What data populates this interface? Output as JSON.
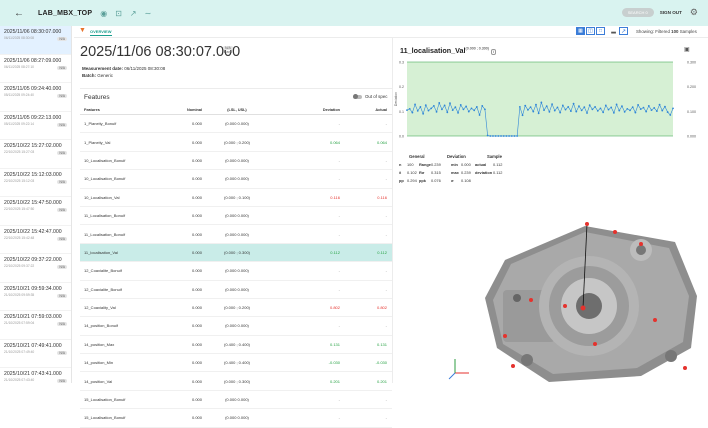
{
  "topbar": {
    "back_icon": "back-arrow-icon",
    "title": "LAB_MBX_TOP",
    "badge": "SEARCH 0",
    "signout": "SIGN OUT"
  },
  "sidebar": {
    "items": [
      {
        "datetime": "2025/11/06 08:30:07.000",
        "sub": "06/11/2025 08:30:08",
        "na": "N/A",
        "active": true
      },
      {
        "datetime": "2025/11/06 08:27:09.000",
        "sub": "06/11/2025 08:27:10",
        "na": "N/A"
      },
      {
        "datetime": "2025/11/05 09:24:40.000",
        "sub": "05/11/2025 09:24:40",
        "na": "N/A"
      },
      {
        "datetime": "2025/11/05 09:22:13.000",
        "sub": "05/11/2025 09:22:14",
        "na": "N/A"
      },
      {
        "datetime": "2025/10/22 15:27:02.000",
        "sub": "22/10/2025 15:27:03",
        "na": "N/A"
      },
      {
        "datetime": "2025/10/22 15:12:03.000",
        "sub": "22/10/2025 15:12:03",
        "na": "N/A"
      },
      {
        "datetime": "2025/10/22 15:47:50.000",
        "sub": "22/10/2025 15:47:50",
        "na": "N/A"
      },
      {
        "datetime": "2025/10/22 15:42:47.000",
        "sub": "22/10/2025 15:42:48",
        "na": "N/A"
      },
      {
        "datetime": "2025/10/22 09:37:22.000",
        "sub": "22/10/2025 09:37:22",
        "na": "N/A"
      },
      {
        "datetime": "2025/10/21 09:59:34.000",
        "sub": "21/10/2025 09:59:35",
        "na": "N/A"
      },
      {
        "datetime": "2025/10/21 07:59:03.000",
        "sub": "21/10/2025 07:59:04",
        "na": "N/A"
      },
      {
        "datetime": "2025/10/21 07:49:41.000",
        "sub": "21/10/2025 07:49:40",
        "na": "N/A"
      },
      {
        "datetime": "2025/10/21 07:43:41.000",
        "sub": "21/10/2025 07:43:40",
        "na": "N/A"
      },
      {
        "datetime": "2025/10/20 09:47:00.000",
        "sub": "20/10/2025 09:47:01",
        "na": "N/A"
      }
    ]
  },
  "tabs": {
    "active": "OVERVIEW"
  },
  "showing": {
    "prefix": "Showing: Filtered",
    "count": "100",
    "suffix": "Samples"
  },
  "header": {
    "datetime": "2025/11/06 08:30:07.000",
    "na": "N/A",
    "na_sub": "Rank",
    "measurement_label": "Measurement date:",
    "measurement_value": "06/11/2025 08:30:08",
    "batch_label": "Batch:",
    "batch_value": "Generic"
  },
  "features": {
    "title": "Features",
    "out_of_spec": "Out of spec",
    "columns": {
      "feature": "Features",
      "nominal": "Nominal",
      "lsl_usl": "(LSL, USL)",
      "deviation": "Deviation",
      "actual": "Actual"
    },
    "rows": [
      {
        "feature": "1_Planeity_Bonuif",
        "nominal": "0.000",
        "range": "(0.000 0.000)",
        "deviation": "-",
        "actual": "-",
        "status": "none"
      },
      {
        "feature": "1_Planeity_Val",
        "nominal": "0.000",
        "range": "(0.000 ; 0.200)",
        "deviation": "0.064",
        "actual": "0.064",
        "status": "ok"
      },
      {
        "feature": "10_Localisation_Bonuif",
        "nominal": "0.000",
        "range": "(0.000 0.000)",
        "deviation": "-",
        "actual": "-",
        "status": "none"
      },
      {
        "feature": "10_Localisation_Bonuif",
        "nominal": "0.000",
        "range": "(0.000 0.000)",
        "deviation": "-",
        "actual": "-",
        "status": "none"
      },
      {
        "feature": "10_Localisation_Val",
        "nominal": "0.000",
        "range": "(0.000 ; 0.100)",
        "deviation": "0.116",
        "actual": "0.116",
        "status": "bad"
      },
      {
        "feature": "11_Localisation_Bonuif",
        "nominal": "0.000",
        "range": "(0.000 0.000)",
        "deviation": "-",
        "actual": "-",
        "status": "none"
      },
      {
        "feature": "11_Localisation_Bonuif",
        "nominal": "0.000",
        "range": "(0.000 0.000)",
        "deviation": "-",
        "actual": "-",
        "status": "none"
      },
      {
        "feature": "11_localisation_Val",
        "nominal": "0.000",
        "range": "(0.000 ; 0.300)",
        "deviation": "0.112",
        "actual": "0.112",
        "status": "ok",
        "selected": true
      },
      {
        "feature": "12_Coaxialite_Bonuif",
        "nominal": "0.000",
        "range": "(0.000 0.000)",
        "deviation": "-",
        "actual": "-",
        "status": "none"
      },
      {
        "feature": "12_Coaxialite_Bonuif",
        "nominal": "0.000",
        "range": "(0.000 0.000)",
        "deviation": "-",
        "actual": "-",
        "status": "none"
      },
      {
        "feature": "12_Coaxiality_Val",
        "nominal": "0.000",
        "range": "(0.000 ; 0.200)",
        "deviation": "0.802",
        "actual": "0.802",
        "status": "bad"
      },
      {
        "feature": "14_position_Bonuif",
        "nominal": "0.000",
        "range": "(0.000 0.000)",
        "deviation": "-",
        "actual": "-",
        "status": "none"
      },
      {
        "feature": "14_position_Max",
        "nominal": "0.000",
        "range": "(0.400 ; 0.400)",
        "deviation": "0.131",
        "actual": "0.131",
        "status": "ok"
      },
      {
        "feature": "14_position_Min",
        "nominal": "0.000",
        "range": "(0.400 ; 0.400)",
        "deviation": "-0.030",
        "actual": "-0.030",
        "status": "ok"
      },
      {
        "feature": "14_position_Val",
        "nominal": "0.000",
        "range": "(0.000 ; 0.300)",
        "deviation": "0.201",
        "actual": "0.201",
        "status": "ok"
      },
      {
        "feature": "15_Localisation_Bonuif",
        "nominal": "0.000",
        "range": "(0.000 0.000)",
        "deviation": "-",
        "actual": "-",
        "status": "none"
      },
      {
        "feature": "15_Localisation_Bonuif",
        "nominal": "0.000",
        "range": "(0.000 0.000)",
        "deviation": "-",
        "actual": "-",
        "status": "none"
      }
    ]
  },
  "chart": {
    "title": "11_localisation_Val",
    "title_sup": "(0.000 ; 0.300)",
    "colors": {
      "line": "#2f86d8",
      "band": "#d6f0d4",
      "limit": "#2e9e42",
      "point": "#2f86d8"
    }
  },
  "chart_data": {
    "type": "line",
    "ylabel": "Deviation",
    "ylim_left": [
      0,
      0.3
    ],
    "y_ticks_left": [
      "0.3",
      "0.2",
      "0.1",
      "0.0"
    ],
    "y_ticks_right": [
      "0.300",
      "0.200",
      "0.100",
      "0.000"
    ],
    "limits": {
      "lsl": 0.0,
      "usl": 0.3
    },
    "series": [
      {
        "values": [
          0.105,
          0.11,
          0.095,
          0.128,
          0.102,
          0.118,
          0.09,
          0.125,
          0.103,
          0.112,
          0.122,
          0.098,
          0.134,
          0.108,
          0.124,
          0.096,
          0.133,
          0.105,
          0.117,
          0.094,
          0.126,
          0.108,
          0.12,
          0.099,
          0.112,
          0.104,
          0.118,
          0.085,
          0.122,
          0.108,
          0.002,
          0.0,
          0.0,
          0.0,
          0.0,
          0.0,
          0.0,
          0.0,
          0.0,
          0.0,
          0.0,
          0.0,
          0.118,
          0.084,
          0.123,
          0.106,
          0.117,
          0.099,
          0.127,
          0.092,
          0.136,
          0.105,
          0.121,
          0.098,
          0.129,
          0.103,
          0.116,
          0.095,
          0.124,
          0.107,
          0.118,
          0.101,
          0.131,
          0.099,
          0.121,
          0.104,
          0.117,
          0.093,
          0.125,
          0.108,
          0.118,
          0.102,
          0.112,
          0.096,
          0.124,
          0.107,
          0.116,
          0.094,
          0.128,
          0.103,
          0.121,
          0.098,
          0.11,
          0.104,
          0.117,
          0.095,
          0.126,
          0.109,
          0.115,
          0.099,
          0.122,
          0.105,
          0.114,
          0.101,
          0.127,
          0.103,
          0.119,
          0.097,
          0.085,
          0.112
        ]
      }
    ]
  },
  "stats": {
    "headers": [
      "General",
      "Deviation",
      "Sample"
    ],
    "rows": [
      [
        "n",
        "100",
        "Range",
        "0.239",
        "min",
        "0.000",
        "actual",
        "0.112"
      ],
      [
        "x̄",
        "0.102",
        "Rσ",
        "0.315",
        "max",
        "0.239",
        "deviation",
        "0.112"
      ],
      [
        "pp",
        "0.294",
        "ppk",
        "0.076",
        "σ",
        "0.108",
        "",
        ""
      ]
    ]
  }
}
